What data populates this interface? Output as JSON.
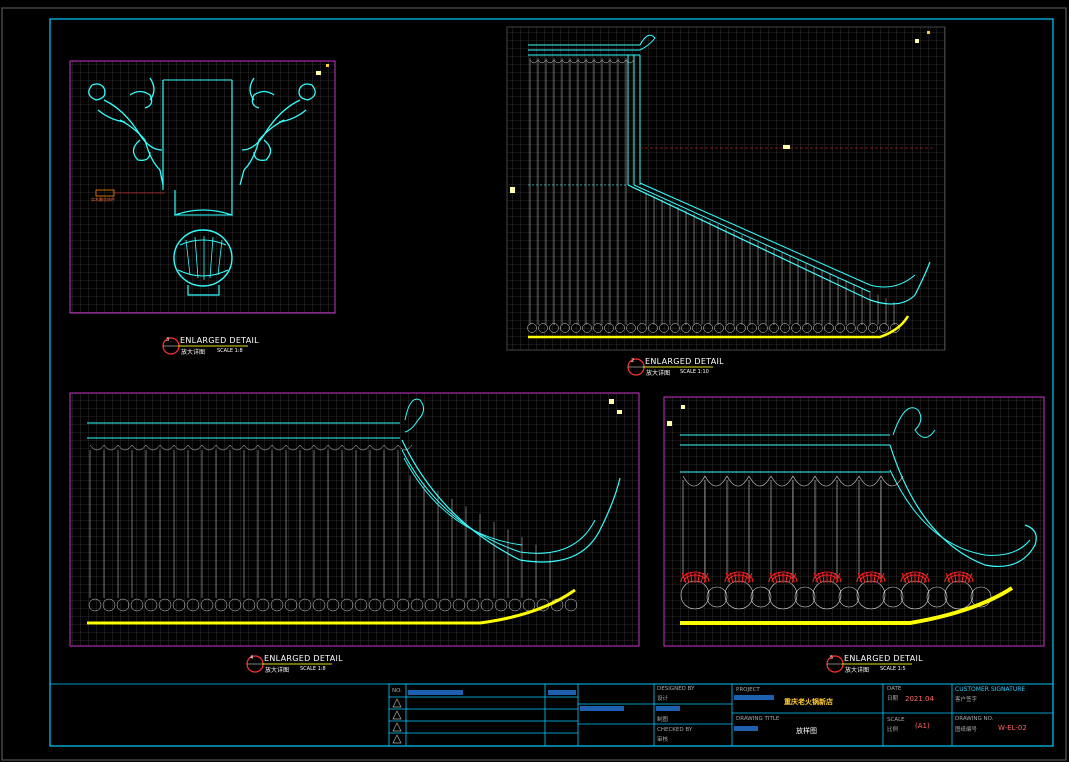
{
  "colors": {
    "background": "#000000",
    "frame": "#00ccff",
    "grid": "#5a5a5a",
    "viewport": "#cc33cc",
    "cyan": "#33ffff",
    "tile": "#e8e8e8",
    "yellow": "#ffff00",
    "red": "#ff2020",
    "marker": "#ff3333"
  },
  "details": [
    {
      "id": "a",
      "marker": "3",
      "title": "ENLARGED DETAIL",
      "subtitle": "放大详图",
      "scale": "SCALE 1:8"
    },
    {
      "id": "b",
      "marker": "2",
      "title": "ENLARGED DETAIL",
      "subtitle": "放大详图",
      "scale": "SCALE 1:10"
    },
    {
      "id": "c",
      "marker": "4",
      "title": "ENLARGED DETAIL",
      "subtitle": "放大详图",
      "scale": "SCALE 1:8"
    },
    {
      "id": "d",
      "marker": "5",
      "title": "ENLARGED DETAIL",
      "subtitle": "放大详图",
      "scale": "SCALE 1:5"
    }
  ],
  "annotation": "实木雕花饰件",
  "title_block": {
    "rev_no_label": "NO.",
    "designed_by_label": "DESIGNED BY",
    "designed_by_cn": "设计",
    "checked_by_label": "CHECKED BY",
    "checked_by_cn": "审核",
    "drawn_cn": "制图",
    "project_label": "PROJECT",
    "project_name": "重庆老火锅新店",
    "drawing_title_label": "DRAWING TITLE",
    "drawing_title": "放样图",
    "date_label": "DATE",
    "date_cn": "日期",
    "date_value": "2021.04",
    "scale_label": "SCALE",
    "scale_cn": "比例",
    "scale_value": "(A1)",
    "customer_signature_label": "CUSTOMER SIGNATURE",
    "customer_signature_cn": "客户签字",
    "drawing_no_label": "DRAWING NO.",
    "drawing_no_cn": "图纸编号",
    "drawing_no_value": "W-EL-02"
  }
}
